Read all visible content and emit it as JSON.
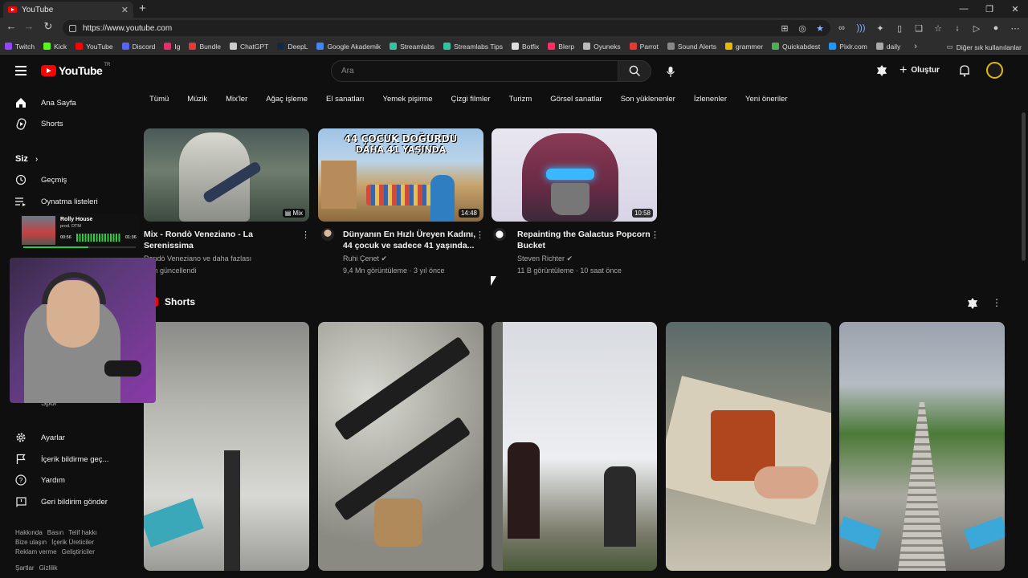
{
  "browser": {
    "tab_title": "YouTube",
    "url": "https://www.youtube.com",
    "bookmarks": [
      {
        "label": "Twitch",
        "color": "#9146ff"
      },
      {
        "label": "Kick",
        "color": "#53fc18"
      },
      {
        "label": "YouTube",
        "color": "#ff0000"
      },
      {
        "label": "Discord",
        "color": "#5865f2"
      },
      {
        "label": "Ig",
        "color": "#e1306c"
      },
      {
        "label": "Bundle",
        "color": "#e53935"
      },
      {
        "label": "ChatGPT",
        "color": "#cccccc"
      },
      {
        "label": "DeepL",
        "color": "#0f2b46"
      },
      {
        "label": "Google Akademik",
        "color": "#4285f4"
      },
      {
        "label": "Streamlabs",
        "color": "#31c3a2"
      },
      {
        "label": "Streamlabs Tips",
        "color": "#31c3a2"
      },
      {
        "label": "Botfix",
        "color": "#dddddd"
      },
      {
        "label": "Blerp",
        "color": "#ff2e63"
      },
      {
        "label": "Oyuneks",
        "color": "#bbbbbb"
      },
      {
        "label": "Parrot",
        "color": "#e53935"
      },
      {
        "label": "Sound Alerts",
        "color": "#888888"
      },
      {
        "label": "grammer",
        "color": "#e6b800"
      },
      {
        "label": "Quickabdest",
        "color": "#4caf50"
      },
      {
        "label": "Pixlr.com",
        "color": "#2196f3"
      },
      {
        "label": "daily",
        "color": "#aaaaaa"
      }
    ],
    "other_bookmarks": "Diğer sık kullanılanlar"
  },
  "header": {
    "logo_text": "YouTube",
    "country_code": "TR",
    "search_placeholder": "Ara",
    "create_label": "Oluştur"
  },
  "sidebar": {
    "main": [
      {
        "label": "Ana Sayfa",
        "icon": "home-icon"
      },
      {
        "label": "Shorts",
        "icon": "shorts-icon"
      }
    ],
    "you_heading": "Siz",
    "you_items": [
      {
        "label": "Geçmiş",
        "icon": "history-icon"
      },
      {
        "label": "Oynatma listeleri",
        "icon": "playlist-icon"
      }
    ],
    "partial_item": "Spor",
    "settings_items": [
      {
        "label": "Ayarlar",
        "icon": "gear-icon"
      },
      {
        "label": "İçerik bildirme geç...",
        "icon": "flag-icon"
      },
      {
        "label": "Yardım",
        "icon": "help-icon"
      },
      {
        "label": "Geri bildirim gönder",
        "icon": "feedback-icon"
      }
    ],
    "footer_row1": [
      "Hakkında",
      "Basın",
      "Telif hakkı"
    ],
    "footer_row2": [
      "Bize ulaşın",
      "İçerik Üreticiler"
    ],
    "footer_row3": [
      "Reklam verme",
      "Geliştiriciler"
    ],
    "footer_row4": [
      "Şartlar",
      "Gizlilik"
    ]
  },
  "chips": [
    "Tümü",
    "Müzik",
    "Mix'ler",
    "Ağaç işleme",
    "El sanatları",
    "Yemek pişirme",
    "Çizgi filmler",
    "Turizm",
    "Görsel sanatlar",
    "Son yüklenenler",
    "İzlenenler",
    "Yeni öneriler"
  ],
  "videos": [
    {
      "title": "Mix - Rondò Veneziano - La Serenissima",
      "channel": "Rondò Veneziano ve daha fazlası",
      "meta": "...ün güncellendi",
      "badge": "Mix"
    },
    {
      "title": "Dünyanın En Hızlı Üreyen Kadını, 44 çocuk ve sadece 41 yaşında...",
      "channel": "Ruhi Çenet",
      "meta": "9,4 Mn görüntüleme · 3 yıl önce",
      "badge": "14:48",
      "thumb_text_1": "44 ÇOCUK DOĞURDU",
      "thumb_text_2": "DAHA 41 YAŞINDA"
    },
    {
      "title": "Repainting the Galactus Popcorn Bucket",
      "channel": "Steven Richter",
      "meta": "11 B görüntüleme · 10 saat önce",
      "badge": "10:58"
    }
  ],
  "shorts_heading": "Shorts",
  "now_playing": {
    "title": "Rolly House",
    "artist": "prod. DTM",
    "elapsed": "00:56",
    "total": "01:36",
    "progress": 0.58
  },
  "colors": {
    "background": "#0f0f0f",
    "brand_red": "#ff0000",
    "text": "#f1f1f1",
    "muted": "#aaaaaa"
  }
}
